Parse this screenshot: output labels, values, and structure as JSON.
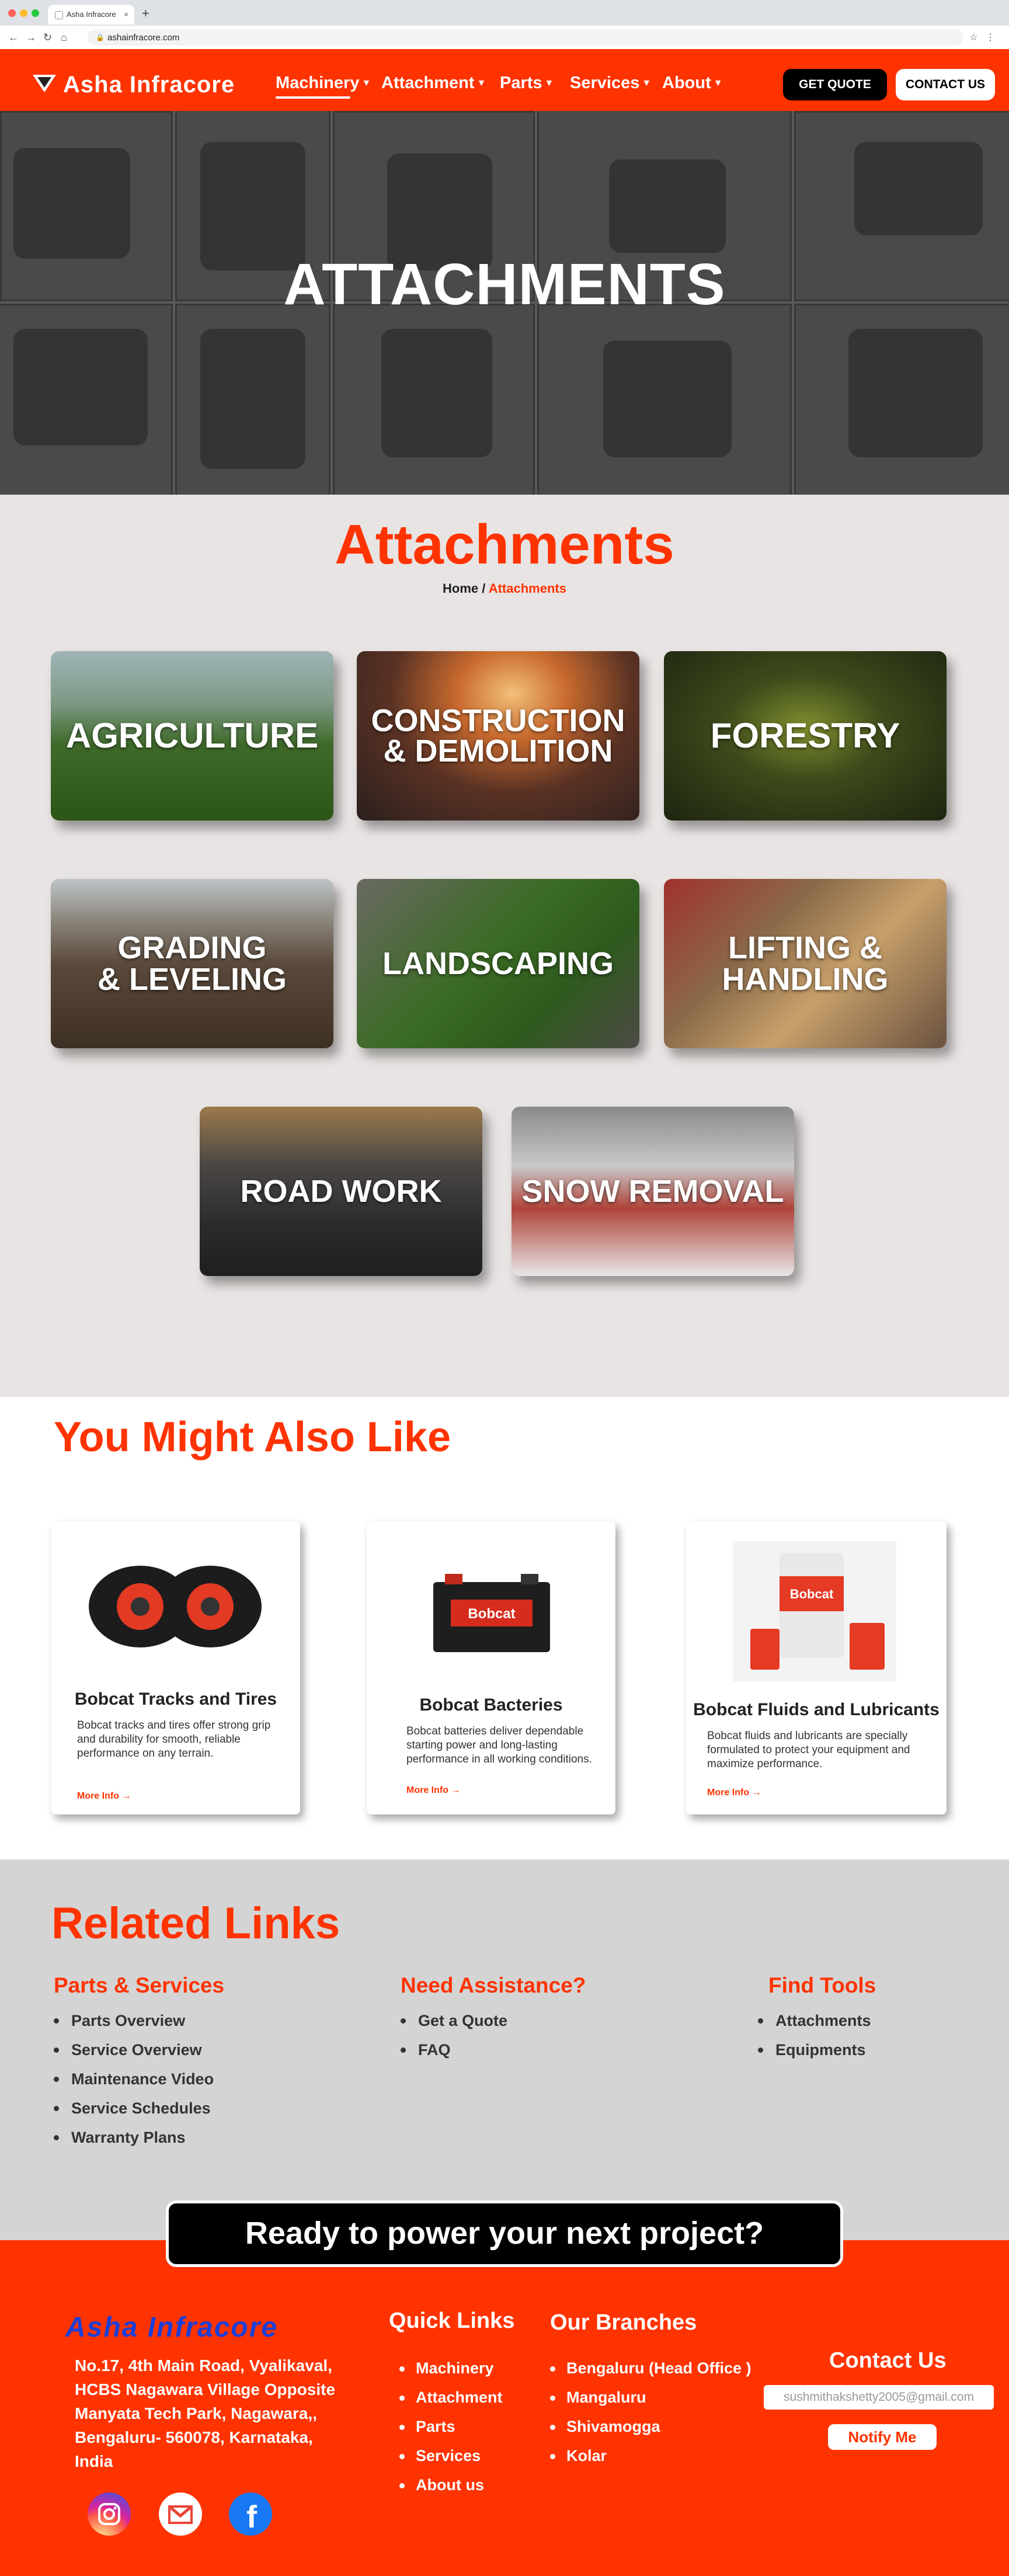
{
  "browser": {
    "tab_title": "Asha Infracore",
    "url": "ashainfracore.com"
  },
  "nav": {
    "logo": "Asha Infracore",
    "links": [
      "Machinery",
      "Attachment",
      "Parts",
      "Services",
      "About"
    ],
    "active": "Machinery",
    "get_quote": "GET QUOTE",
    "contact_us": "CONTACT US"
  },
  "hero": {
    "title": "ATTACHMENTS"
  },
  "section": {
    "title": "Attachments",
    "breadcrumb_home": "Home",
    "breadcrumb_sep": "/",
    "breadcrumb_current": "Attachments"
  },
  "categories": [
    {
      "label": "AGRICULTURE"
    },
    {
      "label": "CONSTRUCTION\n& DEMOLITION"
    },
    {
      "label": "FORESTRY"
    },
    {
      "label": "GRADING\n& LEVELING"
    },
    {
      "label": "LANDSCAPING"
    },
    {
      "label": "LIFTING &\nHANDLING"
    },
    {
      "label": "ROAD WORK"
    },
    {
      "label": "SNOW REMOVAL"
    }
  ],
  "also_like": {
    "title": "You Might Also Like",
    "products": [
      {
        "name": "Bobcat Tracks and Tires",
        "desc": "Bobcat tracks and tires offer strong grip and durability for smooth, reliable performance on any terrain.",
        "more": "More Info →"
      },
      {
        "name": "Bobcat Bacteries",
        "desc": "Bobcat batteries deliver dependable starting power and long-lasting performance in all working conditions.",
        "more": "More Info →"
      },
      {
        "name": "Bobcat Fluids and Lubricants",
        "desc": "Bobcat fluids and lubricants are specially formulated to protect your equipment and maximize performance.",
        "more": "More Info →"
      }
    ]
  },
  "related": {
    "title": "Related Links",
    "groups": [
      {
        "heading": "Parts & Services",
        "items": [
          "Parts Overview",
          "Service Overview",
          "Maintenance Video",
          "Service Schedules",
          "Warranty Plans"
        ]
      },
      {
        "heading": "Need Assistance?",
        "items": [
          "Get a Quote",
          "FAQ"
        ]
      },
      {
        "heading": "Find Tools",
        "items": [
          "Attachments",
          "Equipments"
        ]
      }
    ]
  },
  "cta": {
    "text": "Ready to power your next project?"
  },
  "footer": {
    "logo": "Asha Infracore",
    "address": "No.17, 4th Main Road, Vyalikaval, HCBS Nagawara Village Opposite Manyata Tech Park, Nagawara,, Bengaluru- 560078, Karnataka, India",
    "quick_links_title": "Quick Links",
    "quick_links": [
      "Machinery",
      "Attachment",
      "Parts",
      "Services",
      "About us"
    ],
    "branches_title": "Our Branches",
    "branches": [
      "Bengaluru (Head Office )",
      "Mangaluru",
      "Shivamogga",
      "Kolar"
    ],
    "contact_title": "Contact Us",
    "email_placeholder": "sushmithakshetty2005@gmail.com",
    "notify": "Notify Me"
  },
  "colors": {
    "brand": "#ff3300",
    "logo_blue": "#1a3fd9",
    "dark": "#000000"
  },
  "icons": [
    "instagram-icon",
    "gmail-icon",
    "facebook-icon"
  ]
}
